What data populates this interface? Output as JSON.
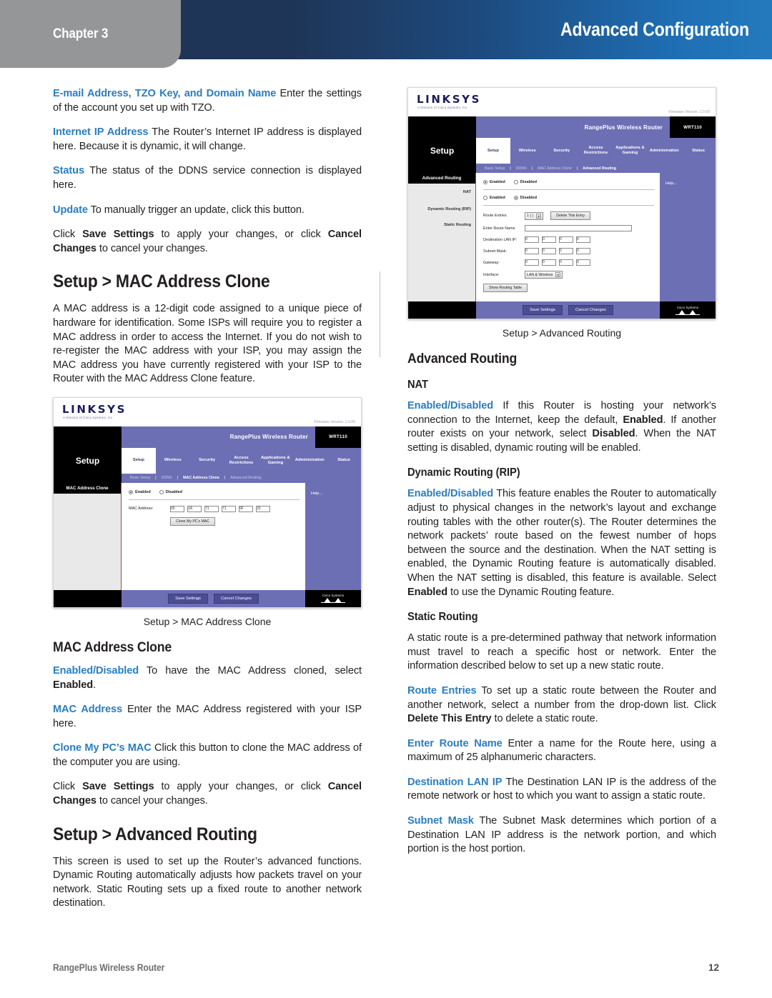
{
  "header": {
    "chapter_label": "Chapter 3",
    "title": "Advanced Configuration",
    "accent_dark": "#1e3557",
    "accent_light": "#2479bd",
    "tab_gray": "#949698"
  },
  "footer": {
    "product": "RangePlus Wireless Router",
    "page_number": "12"
  },
  "left_column": {
    "para_email": {
      "term": "E-mail Address, TZO Key, and Domain Name",
      "text": "Enter the settings of the account you set up with TZO."
    },
    "para_internet_ip": {
      "term": "Internet IP Address",
      "text": "The Router’s Internet IP address is displayed here. Because it is dynamic, it will change."
    },
    "para_status": {
      "term": "Status",
      "text": "The status of the DDNS service connection is displayed here."
    },
    "para_update": {
      "term": "Update",
      "text": "To manually trigger an update, click this button."
    },
    "save_click": {
      "pre": "Click ",
      "b1": "Save Settings",
      "mid": " to apply your changes, or click ",
      "b2": "Cancel Changes",
      "post": " to cancel your changes."
    },
    "heading_mac_clone": "Setup > MAC Address Clone",
    "para_mac_intro": "A MAC address is a 12-digit code assigned to a unique piece of hardware for identification. Some ISPs will require you to register a MAC address in order to access the Internet. If you do not wish to re-register the MAC address with your ISP, you may assign the MAC address you have currently registered with your ISP to the Router with the MAC Address Clone feature.",
    "figure_caption": "Setup > MAC Address Clone",
    "heading_mac_clone_sub": "MAC Address Clone",
    "para_enabled_disabled": {
      "term": "Enabled/Disabled",
      "pre": "To have the MAC Address cloned, select ",
      "bold": "Enabled",
      "post": "."
    },
    "para_mac_address": {
      "term": "MAC Address",
      "text": "Enter the MAC Address registered with your ISP here."
    },
    "para_clone_my_pc": {
      "term": "Clone My PC’s MAC",
      "text": "Click this button to clone the MAC address of the computer you are using."
    },
    "heading_advanced_routing": "Setup > Advanced Routing",
    "para_advanced_routing_intro": "This screen is used to set up the Router’s advanced functions. Dynamic Routing automatically adjusts how packets travel on your network. Static Routing sets up a fixed route to another network destination."
  },
  "right_column": {
    "figure_caption": "Setup > Advanced Routing",
    "heading_advanced_routing": "Advanced Routing",
    "heading_nat": "NAT",
    "para_nat": {
      "term": "Enabled/Disabled",
      "s1": "If this Router is hosting your network’s connection to the Internet, keep the default, ",
      "b1": "Enabled",
      "s2": ". If another router exists on your network, select ",
      "b2": "Disabled",
      "s3": ". When the NAT setting is disabled, dynamic routing will be enabled."
    },
    "heading_dynamic_routing": "Dynamic Routing (RIP)",
    "para_dynamic_routing": {
      "term": "Enabled/Disabled",
      "s1": "This feature enables the Router to automatically adjust to physical changes in the network’s layout and exchange routing tables with the other router(s). The Router determines the network packets’ route based on the fewest number of hops between the source and the destination. When the NAT setting is enabled, the Dynamic Routing feature is automatically disabled. When the NAT setting is disabled, this feature is available. Select ",
      "b1": "Enabled",
      "s2": " to use the Dynamic Routing feature."
    },
    "heading_static_routing": "Static Routing",
    "para_static_intro": "A static route is a pre-determined pathway that network information must travel to reach a specific host or network. Enter the information described below to set up a new static route.",
    "para_route_entries": {
      "term": "Route Entries",
      "s1": "To set up a static route between the Router and another network, select a number from the drop-down list. Click ",
      "b1": "Delete This Entry",
      "s2": " to delete a static route."
    },
    "para_enter_route_name": {
      "term": "Enter Route Name",
      "text": "Enter a name for the Route here, using a maximum of 25 alphanumeric characters."
    },
    "para_destination_lan_ip": {
      "term": "Destination LAN IP",
      "text": "The Destination LAN IP is the address of the remote network or host to which you want to assign a static route."
    },
    "para_subnet_mask": {
      "term": "Subnet Mask",
      "text": "The Subnet Mask determines which portion of a Destination LAN IP address is the network portion, and which portion is the host portion."
    }
  },
  "screenshot_mac_clone": {
    "brand": "LINKSYS",
    "brand_sub": "A Division of Cisco Systems, Inc.",
    "firmware": "Firmware Version: 1.0.00",
    "product_name": "RangePlus Wireless Router",
    "model": "WRT110",
    "section_label": "Setup",
    "tabs": [
      "Setup",
      "Wireless",
      "Security",
      "Access Restrictions",
      "Applications & Gaming",
      "Administration",
      "Status"
    ],
    "active_tab": "Setup",
    "subnav": [
      "Basic Setup",
      "DDNS",
      "MAC Address Clone",
      "Advanced Routing"
    ],
    "active_subnav": "MAC Address Clone",
    "sidebar_title": "MAC Address Clone",
    "radio_enabled": "Enabled",
    "radio_disabled": "Disabled",
    "mac_address_label": "MAC Address:",
    "mac_octets": [
      "00",
      "1A",
      "71",
      "71",
      "9F",
      "33"
    ],
    "clone_button": "Clone My PC's MAC",
    "help_link": "Help...",
    "save_button": "Save Settings",
    "cancel_button": "Cancel Changes",
    "cisco_label": "Cisco Systems"
  },
  "screenshot_advanced_routing": {
    "brand": "LINKSYS",
    "brand_sub": "A Division of Cisco Systems, Inc.",
    "firmware": "Firmware Version: 1.0.00",
    "product_name": "RangePlus Wireless Router",
    "model": "WRT110",
    "section_label": "Setup",
    "tabs": [
      "Setup",
      "Wireless",
      "Security",
      "Access Restrictions",
      "Applications & Gaming",
      "Administration",
      "Status"
    ],
    "active_tab": "Setup",
    "subnav": [
      "Basic Setup",
      "DDNS",
      "MAC Address Clone",
      "Advanced Routing"
    ],
    "active_subnav": "Advanced Routing",
    "sidebar_title": "Advanced Routing",
    "sidebar_items": [
      "NAT",
      "Dynamic Routing (RIP)",
      "Static Routing"
    ],
    "radio_enabled": "Enabled",
    "radio_disabled": "Disabled",
    "route_entries_label": "Route Entries",
    "route_entries_value": "1 ( )",
    "delete_entry_button": "Delete This Entry",
    "enter_route_name_label": "Enter Route Name",
    "enter_route_name_value": "",
    "destination_lan_ip_label": "Destination LAN IP:",
    "destination_lan_ip_octets": [
      "0",
      "0",
      "0",
      "0"
    ],
    "subnet_mask_label": "Subnet Mask:",
    "subnet_mask_octets": [
      "0",
      "0",
      "0",
      "0"
    ],
    "gateway_label": "Gateway:",
    "gateway_octets": [
      "0",
      "0",
      "0",
      "0"
    ],
    "interface_label": "Interface:",
    "interface_value": "LAN & Wireless",
    "show_routing_table_button": "Show Routing Table",
    "help_link": "Help...",
    "save_button": "Save Settings",
    "cancel_button": "Cancel Changes",
    "cisco_label": "Cisco Systems"
  }
}
